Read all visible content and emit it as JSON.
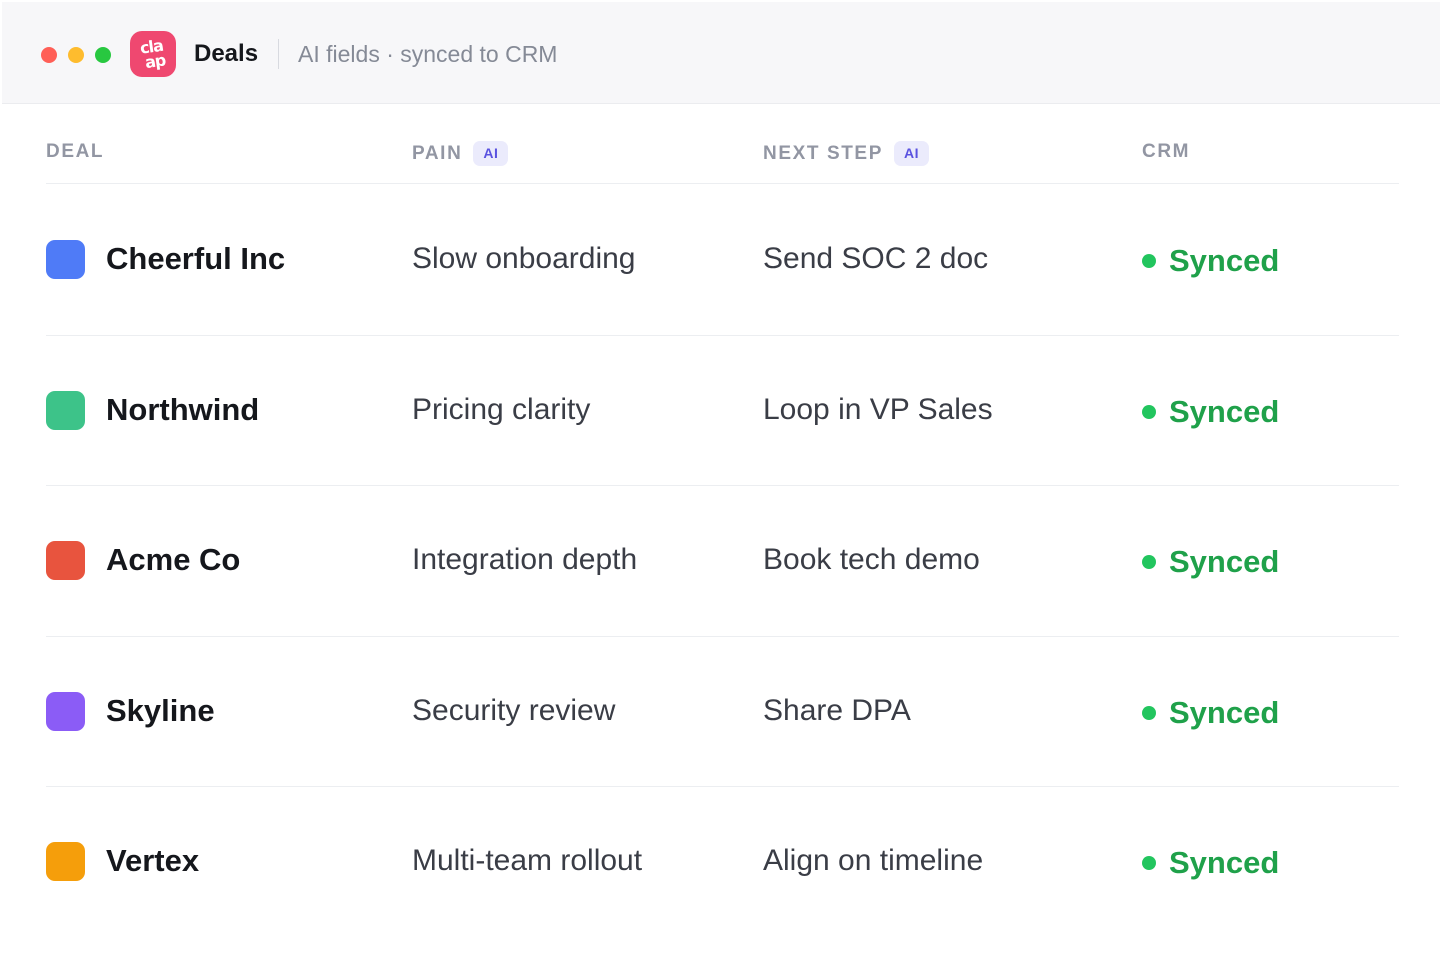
{
  "window": {
    "title": "Deals",
    "subtitle": "AI fields · synced to CRM",
    "logo": {
      "line1": "cla",
      "line2": "ap",
      "color": "#ef4870"
    }
  },
  "table": {
    "columns": [
      {
        "label": "DEAL",
        "badge": ""
      },
      {
        "label": "PAIN",
        "badge": "AI"
      },
      {
        "label": "NEXT STEP",
        "badge": "AI"
      },
      {
        "label": "CRM",
        "badge": ""
      }
    ],
    "rows": [
      {
        "deal": "Cheerful Inc",
        "color": "#4f7bf7",
        "pain": "Slow onboarding",
        "next_step": "Send SOC 2 doc",
        "crm": "Synced"
      },
      {
        "deal": "Northwind",
        "color": "#3dc389",
        "pain": "Pricing clarity",
        "next_step": "Loop in VP Sales",
        "crm": "Synced"
      },
      {
        "deal": "Acme Co",
        "color": "#e8543e",
        "pain": "Integration depth",
        "next_step": "Book tech demo",
        "crm": "Synced"
      },
      {
        "deal": "Skyline",
        "color": "#8b5cf6",
        "pain": "Security review",
        "next_step": "Share DPA",
        "crm": "Synced"
      },
      {
        "deal": "Vertex",
        "color": "#f59e0b",
        "pain": "Multi-team rollout",
        "next_step": "Align on timeline",
        "crm": "Synced"
      }
    ]
  },
  "colors": {
    "status_synced": "#22c55e",
    "accent_ai": "#5a52e0"
  }
}
